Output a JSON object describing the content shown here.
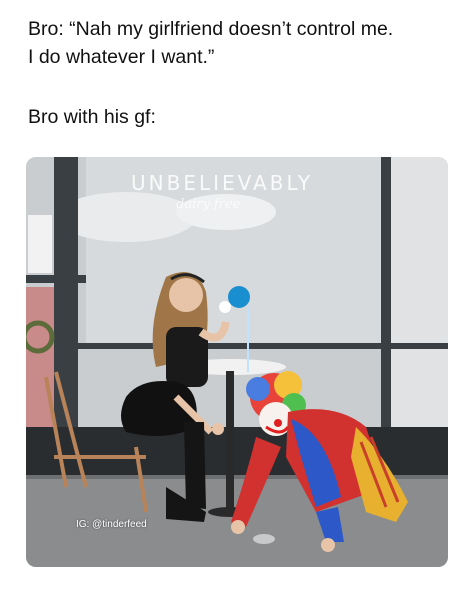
{
  "caption": {
    "line1": "Bro: “Nah my girlfriend doesn’t control me.",
    "line2": "I do whatever I want.”",
    "line3": "Bro with his gf:"
  },
  "photo": {
    "store_sign": "UNBELIEVABLY",
    "store_sign_sub": "dairy free",
    "credit": "IG: @tinderfeed"
  }
}
